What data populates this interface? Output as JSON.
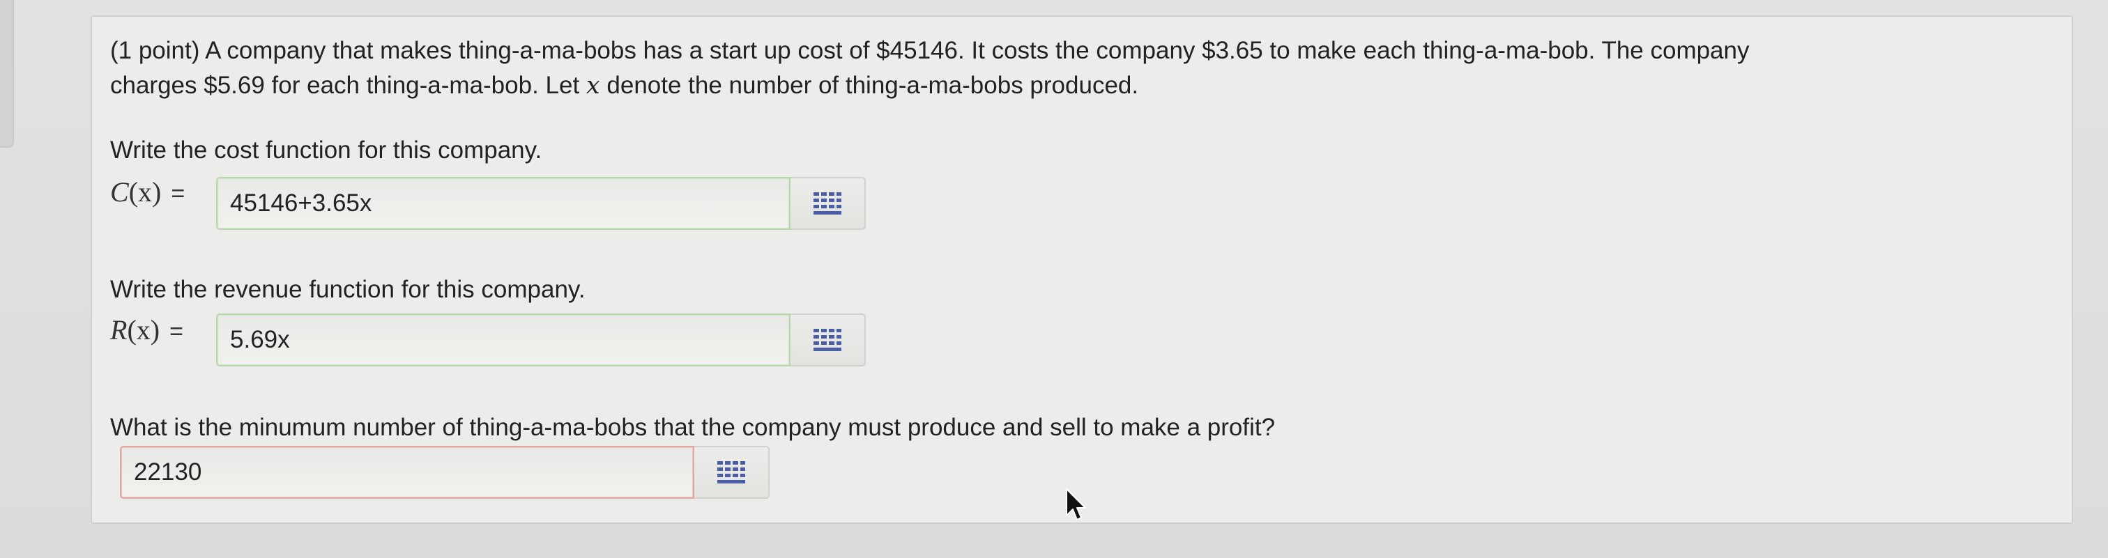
{
  "problem": {
    "points_label": "(1 point)",
    "intro_line1": "A company that makes thing-a-ma-bobs has a start up cost of $45146. It costs the company $3.65 to make each thing-a-ma-bob. The company",
    "intro_line2_before_var": "charges $5.69 for each thing-a-ma-bob. Let ",
    "variable": "x",
    "intro_line2_after_var": " denote the number of thing-a-ma-bobs produced."
  },
  "parts": [
    {
      "question": "Write the cost function for this company.",
      "function_name": "C",
      "function_arg": "(x)",
      "equals": "=",
      "answer_value": "45146+3.65x",
      "status": "correct",
      "equation_editor_icon": "grid-icon"
    },
    {
      "question": "Write the revenue function for this company.",
      "function_name": "R",
      "function_arg": "(x)",
      "equals": "=",
      "answer_value": "5.69x",
      "status": "correct",
      "equation_editor_icon": "grid-icon"
    },
    {
      "question": "What is the minumum number of thing-a-ma-bobs that the company must produce and sell to make a profit?",
      "answer_value": "22130",
      "status": "incorrect",
      "equation_editor_icon": "grid-icon"
    }
  ],
  "colors": {
    "correct_border": "#b9d8b0",
    "incorrect_border": "#e2a6a6",
    "panel_background": "#ececea",
    "icon_color": "#4a5ea8"
  }
}
